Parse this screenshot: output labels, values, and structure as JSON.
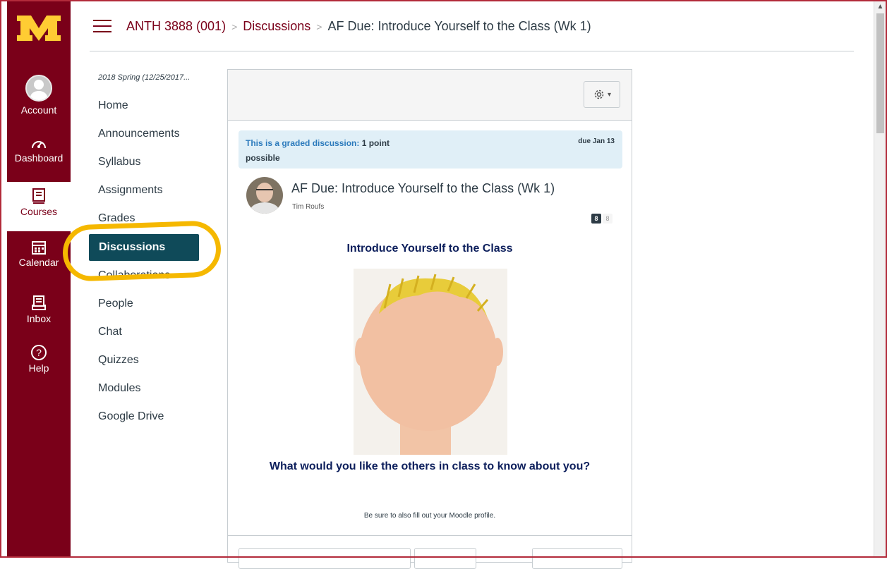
{
  "global_nav": {
    "items": [
      {
        "label": "Account",
        "icon": "user-icon"
      },
      {
        "label": "Dashboard",
        "icon": "dashboard-icon"
      },
      {
        "label": "Courses",
        "icon": "courses-icon",
        "active": true
      },
      {
        "label": "Calendar",
        "icon": "calendar-icon"
      },
      {
        "label": "Inbox",
        "icon": "inbox-icon"
      },
      {
        "label": "Help",
        "icon": "help-icon"
      }
    ]
  },
  "breadcrumb": {
    "course": "ANTH 3888 (001)",
    "section": "Discussions",
    "current": "AF Due: Introduce Yourself to the Class (Wk 1)"
  },
  "course_nav": {
    "term": "2018 Spring (12/25/2017...",
    "items": [
      "Home",
      "Announcements",
      "Syllabus",
      "Assignments",
      "Grades",
      "Discussions",
      "Collaborations",
      "People",
      "Chat",
      "Quizzes",
      "Modules",
      "Google Drive"
    ],
    "active_item": "Discussions"
  },
  "discussion": {
    "graded_label": "This is a graded discussion:",
    "graded_points": "1 point",
    "graded_possible": "possible",
    "due": "due Jan 13",
    "title": "AF Due: Introduce Yourself to the Class (Wk 1)",
    "author": "Tim Roufs",
    "unread_count": "8",
    "total_count": "8",
    "heading": "Introduce Yourself to the Class",
    "question": "What would you like the others in class to know about you?",
    "note": "Be sure to also fill out your Moodle profile."
  },
  "colors": {
    "maroon": "#7a0019",
    "gold": "#ffcc33",
    "active_nav": "#0f4a59",
    "highlight": "#f5b800"
  }
}
